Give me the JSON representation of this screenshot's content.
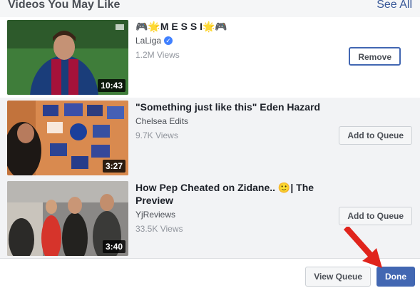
{
  "header": {
    "title": "Videos You May Like",
    "see_all": "See All"
  },
  "videos": [
    {
      "title": "🎮🌟M E S S I🌟🎮",
      "channel": "LaLiga",
      "verified": true,
      "views": "1.2M Views",
      "duration": "10:43",
      "action_label": "Remove"
    },
    {
      "title": "\"Something just like this\" Eden Hazard",
      "channel": "Chelsea Edits",
      "verified": false,
      "views": "9.7K Views",
      "duration": "3:27",
      "action_label": "Add to Queue"
    },
    {
      "title": "How Pep Cheated on Zidane.. 🙂| The Preview",
      "channel": "YjReviews",
      "verified": false,
      "views": "33.5K Views",
      "duration": "3:40",
      "action_label": "Add to Queue"
    }
  ],
  "footer": {
    "view_queue": "View Queue",
    "done": "Done"
  },
  "colors": {
    "accent": "#4267b2",
    "link": "#385898",
    "arrow": "#e0241c"
  }
}
